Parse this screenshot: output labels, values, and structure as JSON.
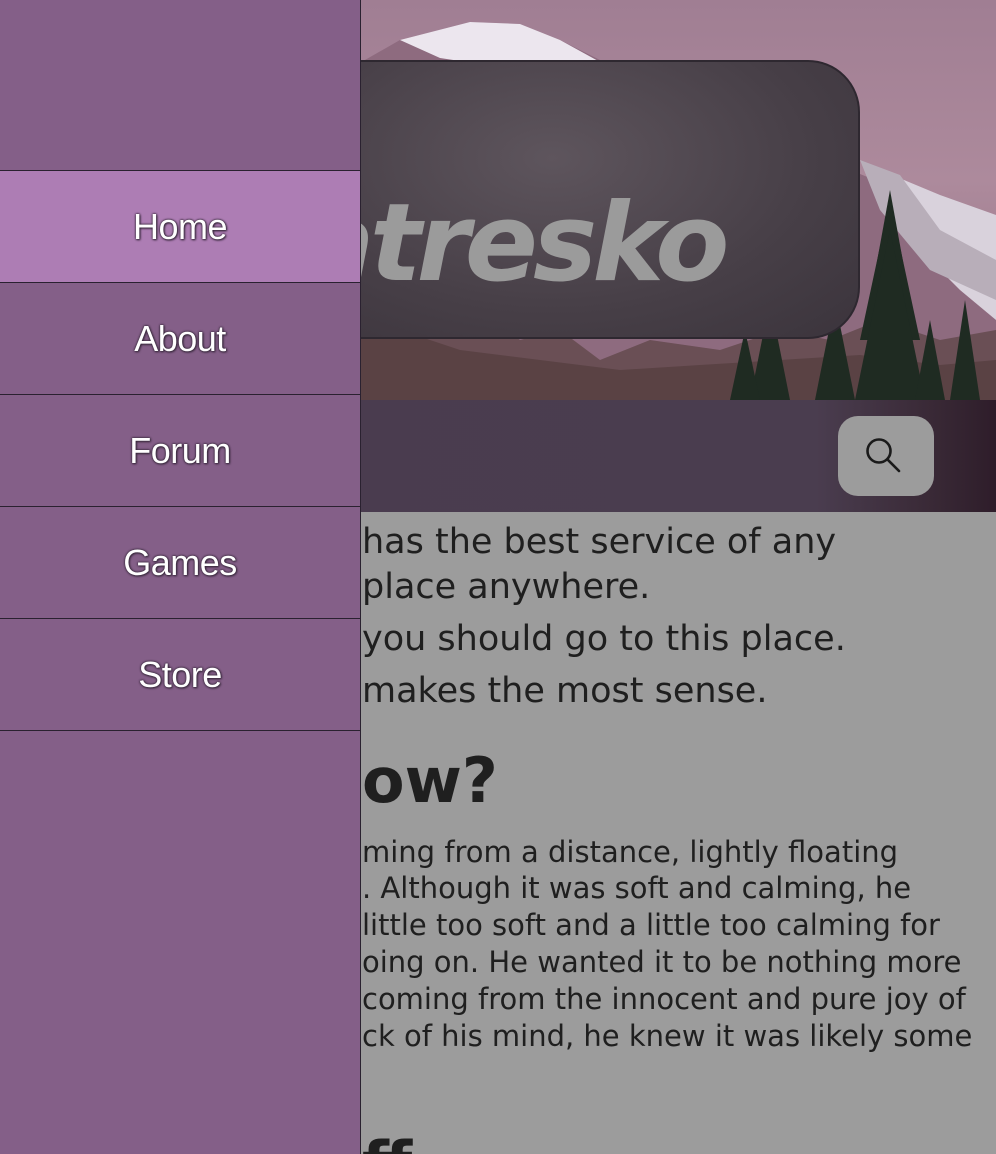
{
  "site": {
    "logo_text": "atresko"
  },
  "nav": {
    "items": [
      {
        "label": "Home",
        "active": true
      },
      {
        "label": "About",
        "active": false
      },
      {
        "label": "Forum",
        "active": false
      },
      {
        "label": "Games",
        "active": false
      },
      {
        "label": "Store",
        "active": false
      }
    ]
  },
  "toolbar": {
    "search_icon": "search-icon"
  },
  "content": {
    "list_lines": [
      "has the best service of any",
      "place anywhere.",
      "you should go to this place.",
      "makes the most sense."
    ],
    "heading": "ow?",
    "paragraph_lines": [
      "ming from a distance, lightly floating",
      ". Although it was soft and calming, he",
      "little too soft and a little too calming for",
      "oing on. He wanted it to be nothing more",
      "coming from the innocent and pure joy of",
      "ck of his mind, he knew it was likely some"
    ],
    "next_heading": "ff"
  },
  "colors": {
    "drawer": "#845f88",
    "drawer_active": "#ad7db4",
    "toolbar": "#4a3c4f",
    "content_bg": "#9c9c9c"
  }
}
